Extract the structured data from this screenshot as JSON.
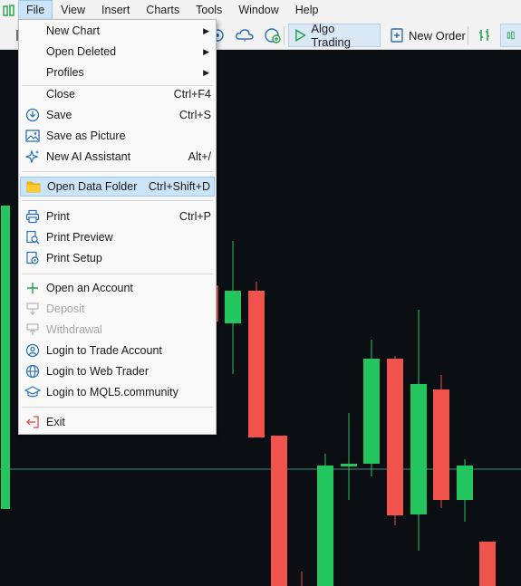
{
  "menubar": {
    "app_icon": "candlestick-app-icon",
    "items": [
      "File",
      "View",
      "Insert",
      "Charts",
      "Tools",
      "Window",
      "Help"
    ]
  },
  "toolbar": {
    "algo_trading_label": "Algo Trading",
    "new_order_label": "New Order"
  },
  "file_menu": {
    "items": [
      {
        "label": "New Chart",
        "shortcut": "",
        "submenu": true
      },
      {
        "label": "Open Deleted",
        "shortcut": "",
        "submenu": true
      },
      {
        "label": "Profiles",
        "shortcut": "",
        "submenu": true
      },
      {
        "label": "Close",
        "shortcut": "Ctrl+F4"
      },
      {
        "label": "Save",
        "shortcut": "Ctrl+S",
        "icon": "save-icon"
      },
      {
        "label": "Save as Picture",
        "shortcut": "",
        "icon": "picture-icon"
      },
      {
        "label": "New AI Assistant",
        "shortcut": "Alt+/",
        "icon": "sparkle-icon"
      },
      {
        "label": "Open Data Folder",
        "shortcut": "Ctrl+Shift+D",
        "icon": "folder-icon",
        "highlighted": true
      },
      {
        "label": "Print",
        "shortcut": "Ctrl+P",
        "icon": "printer-icon"
      },
      {
        "label": "Print Preview",
        "shortcut": "",
        "icon": "print-preview-icon"
      },
      {
        "label": "Print Setup",
        "shortcut": "",
        "icon": "print-setup-icon"
      },
      {
        "label": "Open an Account",
        "shortcut": "",
        "icon": "plus-icon"
      },
      {
        "label": "Deposit",
        "shortcut": "",
        "icon": "deposit-icon",
        "disabled": true
      },
      {
        "label": "Withdrawal",
        "shortcut": "",
        "icon": "withdrawal-icon",
        "disabled": true
      },
      {
        "label": "Login to Trade Account",
        "shortcut": "",
        "icon": "user-icon"
      },
      {
        "label": "Login to Web Trader",
        "shortcut": "",
        "icon": "globe-icon"
      },
      {
        "label": "Login to MQL5.community",
        "shortcut": "",
        "icon": "graduation-cap-icon"
      },
      {
        "label": "Exit",
        "shortcut": "",
        "icon": "exit-icon"
      }
    ]
  },
  "colors": {
    "bull": "#22c55e",
    "bear": "#f0534c",
    "chart_bg": "#0b0e13",
    "price_line": "#5fb3a0",
    "highlight": "#cce4f7"
  }
}
